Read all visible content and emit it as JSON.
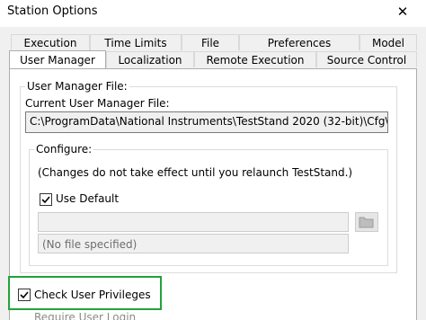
{
  "window": {
    "title": "Station Options",
    "close_glyph": "✕"
  },
  "tabs": {
    "row1": [
      "Execution",
      "Time Limits",
      "File",
      "Preferences",
      "Model"
    ],
    "row2": [
      "User Manager",
      "Localization",
      "Remote Execution",
      "Source Control"
    ],
    "active": "User Manager"
  },
  "user_manager_file": {
    "group_label": "User Manager File:",
    "current_label": "Current User Manager File:",
    "current_value": "C:\\ProgramData\\National Instruments\\TestStand 2020 (32-bit)\\Cfg\\Users.ini"
  },
  "configure": {
    "group_label": "Configure:",
    "note": "(Changes do not take effect until you relaunch TestStand.)",
    "use_default_label": "Use Default",
    "use_default_checked": true,
    "path_value": "",
    "file_status": "(No file specified)",
    "folder_icon": "folder-icon"
  },
  "check_user_privileges": {
    "label": "Check User Privileges",
    "checked": true
  },
  "require_user_login": {
    "label": "Require User Login"
  },
  "colors": {
    "highlight": "#22a33c",
    "active_tab": "#ffffff",
    "dialog_bg": "#f0f0f0"
  }
}
